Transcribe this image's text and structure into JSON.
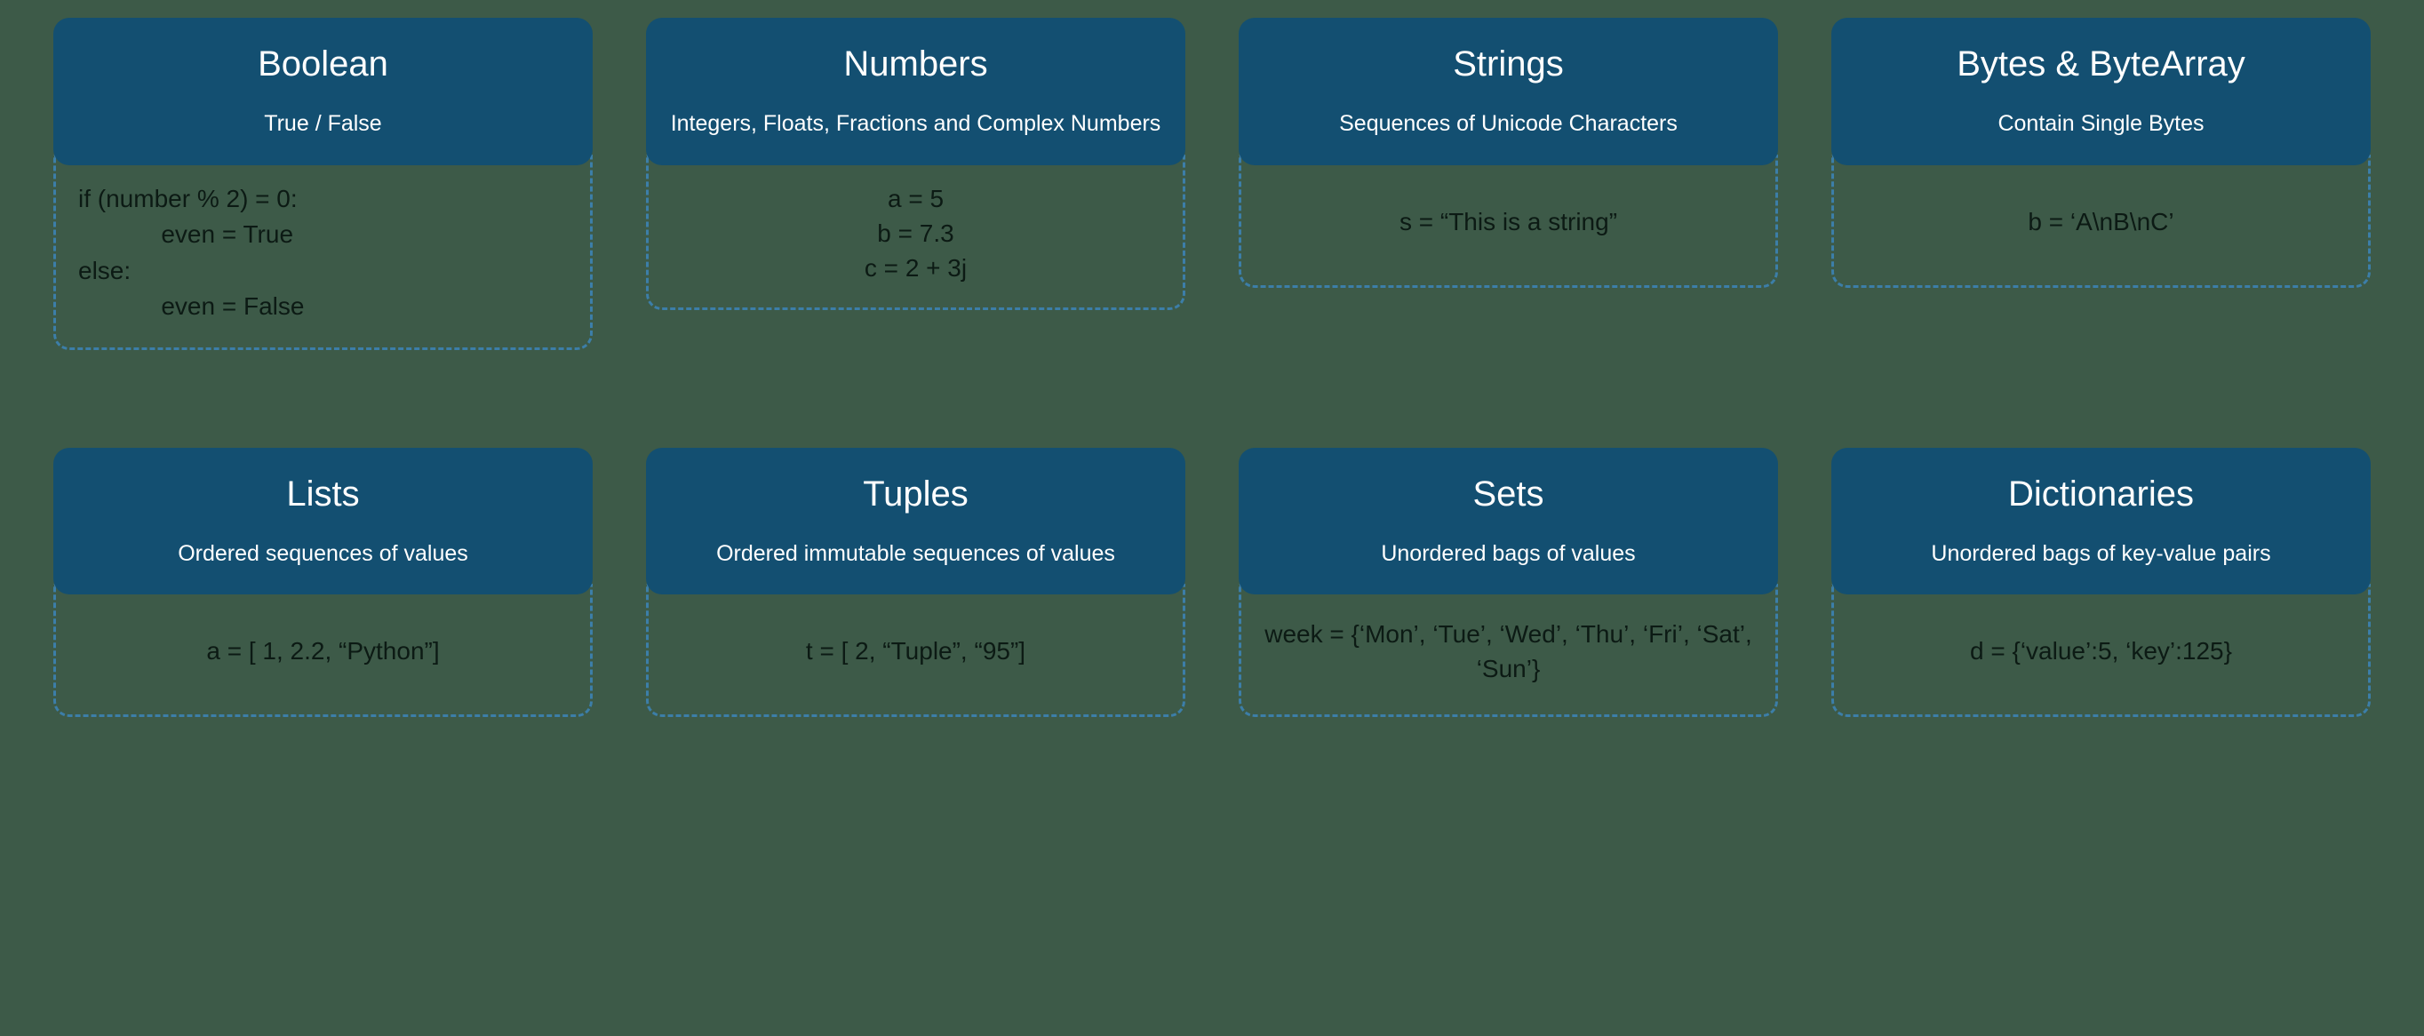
{
  "cards": [
    {
      "title": "Boolean",
      "subtitle": "True / False",
      "body": "if (number % 2) = 0:\n            even = True\nelse:\n            even = False",
      "body_style": "code-left"
    },
    {
      "title": "Numbers",
      "subtitle": "Integers, Floats, Fractions and Complex Numbers",
      "body": "a = 5\nb = 7.3\nc = 2 + 3j",
      "body_style": "multiline-center"
    },
    {
      "title": "Strings",
      "subtitle": "Sequences of Unicode Characters",
      "body": "s = “This is a string”",
      "body_style": "centered"
    },
    {
      "title": "Bytes & ByteArray",
      "subtitle": "Contain Single Bytes",
      "body": "b = ‘A\\nB\\nC’",
      "body_style": "centered"
    },
    {
      "title": "Lists",
      "subtitle": "Ordered sequences of values",
      "body": "a = [ 1, 2.2, “Python”]",
      "body_style": "centered"
    },
    {
      "title": "Tuples",
      "subtitle": "Ordered immutable sequences of values",
      "body": "t = [ 2, “Tuple”, “95”]",
      "body_style": "centered"
    },
    {
      "title": "Sets",
      "subtitle": "Unordered bags of values",
      "body": "week = {‘Mon’, ‘Tue’, ‘Wed’, ‘Thu’, ‘Fri’, ‘Sat’, ‘Sun’}",
      "body_style": "multiline-center"
    },
    {
      "title": "Dictionaries",
      "subtitle": "Unordered bags of key-value pairs",
      "body": "d = {‘value’:5, ‘key’:125}",
      "body_style": "centered"
    }
  ]
}
